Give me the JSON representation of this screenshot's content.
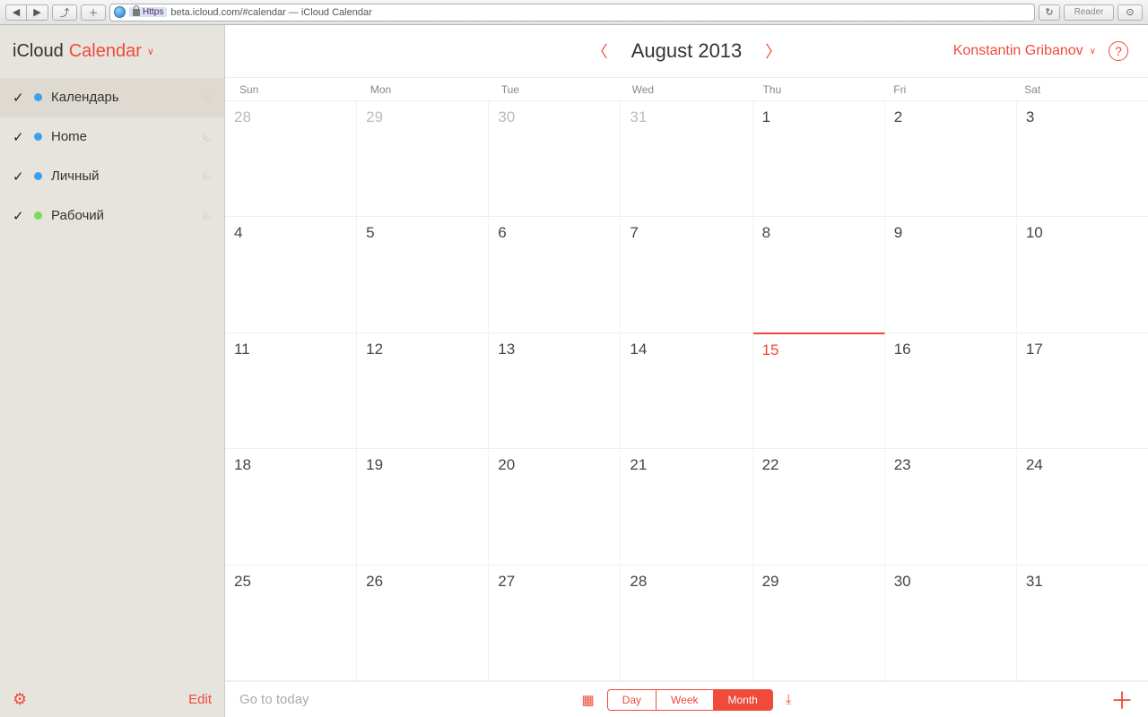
{
  "browser": {
    "url": "beta.icloud.com/#calendar — iCloud Calendar",
    "https": "Https",
    "reader": "Reader"
  },
  "sidebar": {
    "title1": "iCloud",
    "title2": "Calendar",
    "calendars": [
      {
        "label": "Календарь",
        "color": "#3fa0ea",
        "checked": true
      },
      {
        "label": "Home",
        "color": "#3fa0ea",
        "checked": true
      },
      {
        "label": "Личный",
        "color": "#3fa0ea",
        "checked": true
      },
      {
        "label": "Рабочий",
        "color": "#7dd957",
        "checked": true
      }
    ],
    "edit": "Edit"
  },
  "header": {
    "month": "August",
    "year": "2013"
  },
  "user": {
    "name": "Konstantin Gribanov"
  },
  "dow": [
    "Sun",
    "Mon",
    "Tue",
    "Wed",
    "Thu",
    "Fri",
    "Sat"
  ],
  "weeks": [
    [
      {
        "n": "28",
        "dim": true
      },
      {
        "n": "29",
        "dim": true
      },
      {
        "n": "30",
        "dim": true
      },
      {
        "n": "31",
        "dim": true
      },
      {
        "n": "1"
      },
      {
        "n": "2"
      },
      {
        "n": "3"
      }
    ],
    [
      {
        "n": "4"
      },
      {
        "n": "5"
      },
      {
        "n": "6"
      },
      {
        "n": "7"
      },
      {
        "n": "8"
      },
      {
        "n": "9"
      },
      {
        "n": "10"
      }
    ],
    [
      {
        "n": "11"
      },
      {
        "n": "12"
      },
      {
        "n": "13"
      },
      {
        "n": "14"
      },
      {
        "n": "15",
        "today": true
      },
      {
        "n": "16"
      },
      {
        "n": "17"
      }
    ],
    [
      {
        "n": "18"
      },
      {
        "n": "19"
      },
      {
        "n": "20"
      },
      {
        "n": "21"
      },
      {
        "n": "22"
      },
      {
        "n": "23"
      },
      {
        "n": "24"
      }
    ],
    [
      {
        "n": "25"
      },
      {
        "n": "26"
      },
      {
        "n": "27"
      },
      {
        "n": "28"
      },
      {
        "n": "29"
      },
      {
        "n": "30"
      },
      {
        "n": "31"
      }
    ]
  ],
  "footer": {
    "today": "Go to today",
    "views": {
      "day": "Day",
      "week": "Week",
      "month": "Month"
    }
  }
}
